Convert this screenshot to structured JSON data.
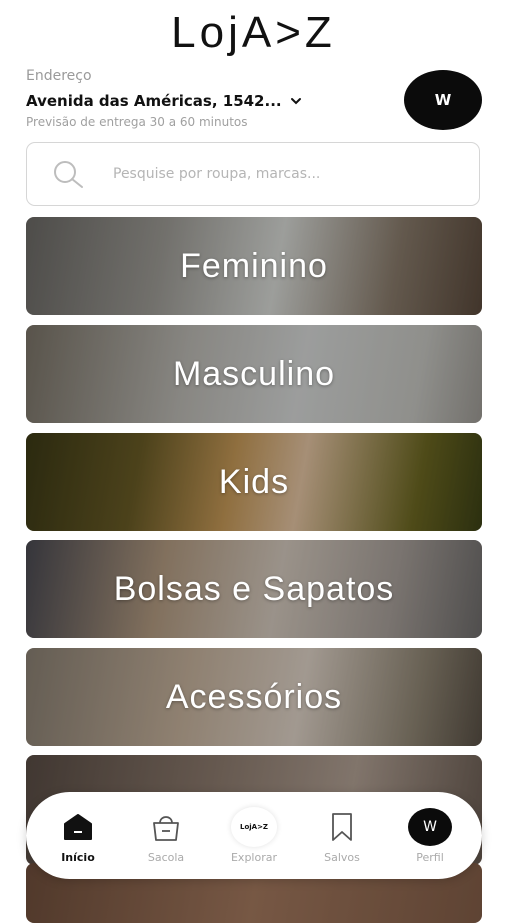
{
  "header": {
    "logo": "LojA>Z",
    "address_label": "Endereço",
    "address_value": "Avenida das Américas, 1542...",
    "delivery_estimate": "Previsão de entrega 30 a 60 minutos",
    "avatar_initial": "W"
  },
  "search": {
    "placeholder": "Pesquise por roupa, marcas..."
  },
  "categories": [
    {
      "label": "Feminino"
    },
    {
      "label": "Masculino"
    },
    {
      "label": "Kids"
    },
    {
      "label": "Bolsas e Sapatos"
    },
    {
      "label": "Acessórios"
    }
  ],
  "nav": {
    "items": [
      {
        "label": "Início",
        "icon": "home-icon",
        "active": true
      },
      {
        "label": "Sacola",
        "icon": "bag-icon",
        "active": false
      },
      {
        "label": "Explorar",
        "icon": "explore-logo-icon",
        "active": false,
        "badge_text": "LojA>Z"
      },
      {
        "label": "Salvos",
        "icon": "bookmark-icon",
        "active": false
      },
      {
        "label": "Perfil",
        "icon": "profile-avatar",
        "active": false,
        "avatar_initial": "W"
      }
    ]
  }
}
